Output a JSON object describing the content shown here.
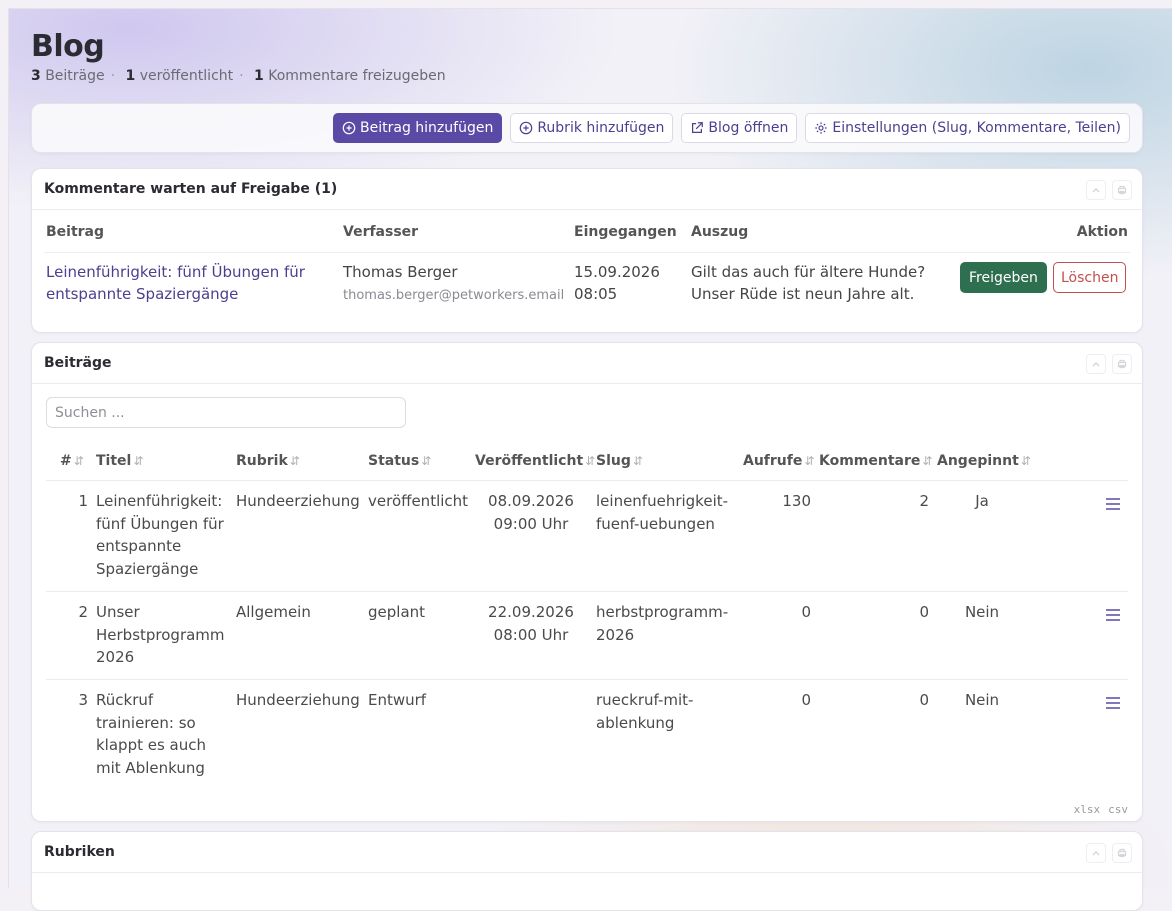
{
  "page": {
    "title": "Blog",
    "stats": [
      {
        "count": "3",
        "label": "Beiträge"
      },
      {
        "count": "1",
        "label": "veröffentlicht"
      },
      {
        "count": "1",
        "label": "Kommentare freizugeben"
      }
    ]
  },
  "toolbar": {
    "add_post": "Beitrag hinzufügen",
    "add_category": "Rubrik hinzufügen",
    "open_blog": "Blog öffnen",
    "settings": "Einstellungen (Slug, Kommentare, Teilen)"
  },
  "comments": {
    "title": "Kommentare warten auf Freigabe (1)",
    "columns": [
      "Beitrag",
      "Verfasser",
      "Eingegangen",
      "Auszug",
      "Aktion"
    ],
    "rows": [
      {
        "post_line1": "Leinenführigkeit: fünf Übungen für",
        "post_line2": "entspannte Spaziergänge",
        "author": "Thomas Berger",
        "email": "thomas.berger@petworkers.email",
        "date": "15.09.2026",
        "time": "08:05",
        "excerpt_line1": "Gilt das auch für ältere Hunde?",
        "excerpt_line2": "Unser Rüde ist neun Jahre alt.",
        "approve": "Freigeben",
        "delete": "Löschen"
      }
    ]
  },
  "posts": {
    "title": "Beiträge",
    "search_placeholder": "Suchen ...",
    "columns": {
      "num": "#",
      "title": "Titel",
      "category": "Rubrik",
      "status": "Status",
      "published": "Veröffentlicht",
      "slug": "Slug",
      "views": "Aufrufe",
      "comments": "Kommentare",
      "pinned": "Angepinnt"
    },
    "rows": [
      {
        "num": "1",
        "title": [
          "Leinenführigkeit:",
          "fünf Übungen für",
          "entspannte",
          "Spaziergänge"
        ],
        "category": "Hundeerziehung",
        "status": "veröffentlicht",
        "published": [
          "08.09.2026",
          "09:00 Uhr"
        ],
        "slug": [
          "leinenfuehrigkeit-",
          "fuenf-uebungen"
        ],
        "views": "130",
        "comments": "2",
        "pinned": "Ja"
      },
      {
        "num": "2",
        "title": [
          "Unser",
          "Herbstprogramm",
          "2026"
        ],
        "category": "Allgemein",
        "status": "geplant",
        "published": [
          "22.09.2026",
          "08:00 Uhr"
        ],
        "slug": [
          "herbstprogramm-",
          "2026"
        ],
        "views": "0",
        "comments": "0",
        "pinned": "Nein"
      },
      {
        "num": "3",
        "title": [
          "Rückruf",
          "trainieren: so",
          "klappt es auch",
          "mit Ablenkung"
        ],
        "category": "Hundeerziehung",
        "status": "Entwurf",
        "published": [
          "",
          ""
        ],
        "slug": [
          "rueckruf-mit-",
          "ablenkung"
        ],
        "views": "0",
        "comments": "0",
        "pinned": "Nein"
      }
    ],
    "export": [
      "xlsx",
      "csv"
    ]
  },
  "categories": {
    "title": "Rubriken"
  }
}
